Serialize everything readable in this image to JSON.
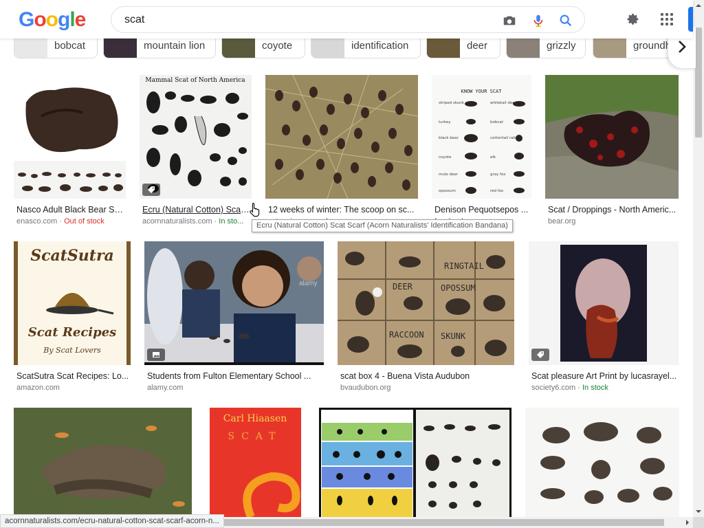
{
  "header": {
    "logo_letters": [
      "G",
      "o",
      "o",
      "g",
      "l",
      "e"
    ],
    "search_value": "scat"
  },
  "chips": [
    {
      "label": "bobcat"
    },
    {
      "label": "mountain lion"
    },
    {
      "label": "coyote"
    },
    {
      "label": "identification"
    },
    {
      "label": "deer"
    },
    {
      "label": "grizzly"
    },
    {
      "label": "groundh"
    }
  ],
  "results": [
    {
      "title": "Nasco Adult Black Bear Sc...",
      "source": "enasco.com",
      "stock": "Out of stock"
    },
    {
      "title": "Ecru (Natural Cotton) Scat ...",
      "source": "acornnaturalists.com",
      "stock": "In sto..."
    },
    {
      "title": "12 weeks of winter: The scoop on sc...",
      "source": "extension.umn.edu",
      "stock": ""
    },
    {
      "title": "Denison Pequotsepos ...",
      "source": "facebook.com",
      "stock": ""
    },
    {
      "title": "Scat / Droppings - North Americ...",
      "source": "bear.org",
      "stock": ""
    },
    {
      "title": "ScatSutra Scat Recipes: Lo...",
      "source": "amazon.com",
      "stock": ""
    },
    {
      "title": "Students from Fulton Elementary School ...",
      "source": "alamy.com",
      "stock": ""
    },
    {
      "title": "scat box 4 - Buena Vista Audubon",
      "source": "bvaudubon.org",
      "stock": ""
    },
    {
      "title": "Scat pleasure Art Print by lucasrayel...",
      "source": "society6.com",
      "stock": "In stock"
    }
  ],
  "image_text": {
    "mammal_chart_title": "Mammal Scat of North America",
    "know_your_scat": "KNOW YOUR SCAT",
    "know_labels": [
      "striped skunk",
      "whitetail deer",
      "turkey",
      "bobcat",
      "black bear",
      "cottontail rabbit",
      "coyote",
      "elk",
      "mule deer",
      "gray fox",
      "opossum",
      "red fox"
    ],
    "scatsutra_title": "ScatSutra",
    "scatsutra_sub": "Scat Recipes",
    "scatsutra_by": "By Scat Lovers",
    "box_labels": [
      "RINGTAIL",
      "DEER",
      "OPOSSUM",
      "RACCOON",
      "SKUNK"
    ],
    "book_author": "Carl Hiaasen",
    "book_title": "SCAT",
    "watermark": "alamy"
  },
  "tooltip": "Ecru (Natural Cotton) Scat Scarf (Acorn Naturalists' Identification Bandana)",
  "status_url": "acornnaturalists.com/ecru-natural-cotton-scat-scarf-acorn-n...",
  "colors": {
    "accent": "#1a73e8",
    "stock_out": "#d93025",
    "stock_in": "#188038",
    "muted": "#70757a"
  }
}
